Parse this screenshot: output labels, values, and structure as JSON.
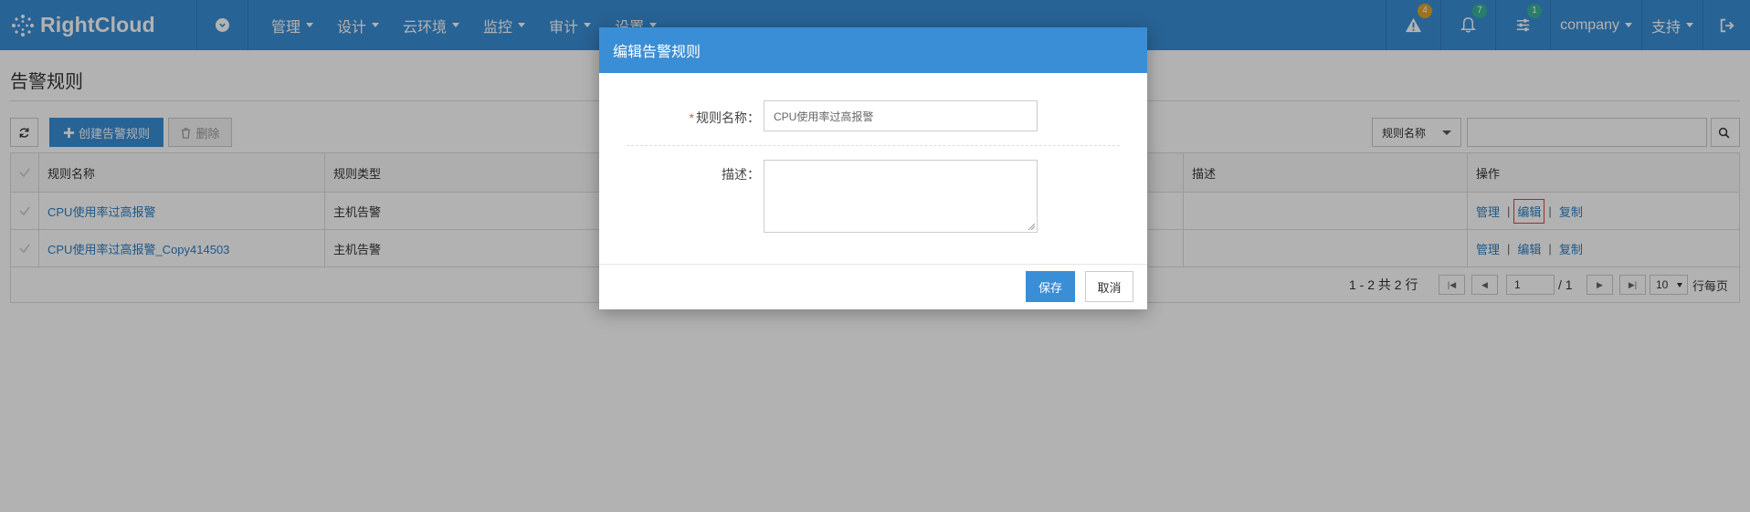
{
  "brand": {
    "name": "RightCloud"
  },
  "nav": {
    "items": [
      {
        "label": "管理"
      },
      {
        "label": "设计"
      },
      {
        "label": "云环境"
      },
      {
        "label": "监控"
      },
      {
        "label": "审计"
      },
      {
        "label": "设置"
      }
    ],
    "alerts_badge": "4",
    "notifications_badge": "7",
    "tasks_badge": "1",
    "tenant": "company",
    "support": "支持"
  },
  "page": {
    "title": "告警规则",
    "toolbar": {
      "create_label": "创建告警规则",
      "delete_label": "删除",
      "filter_select": "规则名称",
      "search_placeholder": ""
    },
    "table": {
      "headers": {
        "name": "规则名称",
        "type": "规则类型",
        "description": "描述",
        "operations": "操作"
      },
      "rows": [
        {
          "name": "CPU使用率过高报警",
          "type": "主机告警",
          "description": "",
          "ops": [
            "管理",
            "编辑",
            "复制"
          ]
        },
        {
          "name": "CPU使用率过高报警_Copy414503",
          "type": "主机告警",
          "description": "",
          "ops": [
            "管理",
            "编辑",
            "复制"
          ]
        }
      ]
    },
    "pager": {
      "summary": "1 - 2 共 2 行",
      "current_page": "1",
      "total_pages": "/ 1",
      "page_size": "10",
      "page_size_label": "行每页"
    }
  },
  "modal": {
    "title": "编辑告警规则",
    "name_label": "规则名称：",
    "name_value": "CPU使用率过高报警",
    "desc_label": "描述：",
    "desc_value": "",
    "save_label": "保存",
    "cancel_label": "取消"
  },
  "colors": {
    "primary": "#3a8ed6",
    "badge_yellow": "#e2a52a",
    "badge_green": "#3cb49a",
    "required": "#d9534f"
  }
}
